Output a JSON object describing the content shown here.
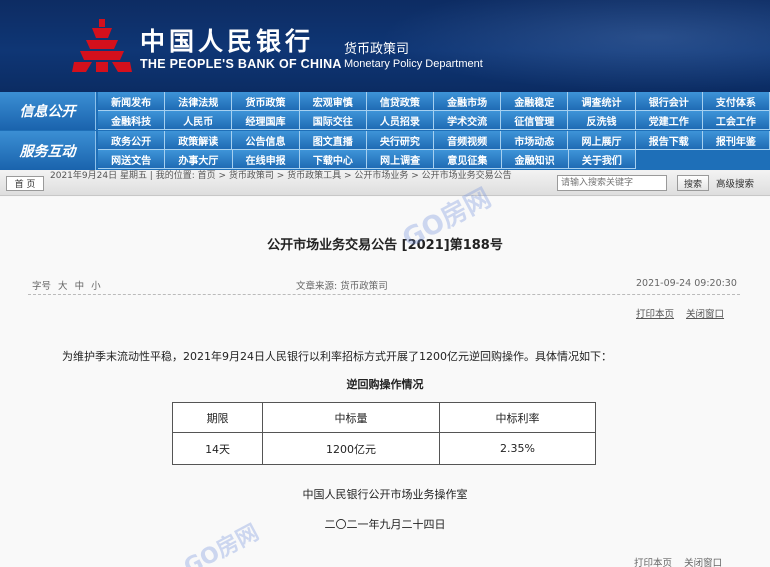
{
  "header": {
    "bank_name_cn": "中国人民银行",
    "bank_name_en": "THE PEOPLE'S BANK OF CHINA",
    "dept_cn": "货币政策司",
    "dept_en": "Monetary Policy Department"
  },
  "nav": {
    "block_1": "信息公开",
    "block_2": "服务互动",
    "rows": [
      [
        "新闻发布",
        "法律法规",
        "货币政策",
        "宏观审慎",
        "信贷政策",
        "金融市场",
        "金融稳定",
        "调查统计",
        "银行会计",
        "支付体系"
      ],
      [
        "金融科技",
        "人民币",
        "经理国库",
        "国际交往",
        "人员招录",
        "学术交流",
        "征信管理",
        "反洗钱",
        "党建工作",
        "工会工作"
      ],
      [
        "政务公开",
        "政策解读",
        "公告信息",
        "图文直播",
        "央行研究",
        "音频视频",
        "市场动态",
        "网上展厅",
        "报告下载",
        "报刊年鉴"
      ],
      [
        "网送文告",
        "办事大厅",
        "在线申报",
        "下载中心",
        "网上调查",
        "意见征集",
        "金融知识",
        "关于我们"
      ]
    ]
  },
  "crumb_bar": {
    "home_label": "首 页",
    "breadcrumb": "2021年9月24日 星期五 | 我的位置: 首页 > 货币政策司 > 货币政策工具 > 公开市场业务 > 公开市场业务交易公告",
    "search_placeholder": "请输入搜索关键字",
    "search_button": "搜索",
    "advanced_search": "高级搜索"
  },
  "article": {
    "title": "公开市场业务交易公告 [2021]第188号",
    "font_size_label": "字号",
    "font_sizes": [
      "大",
      "中",
      "小"
    ],
    "source": "文章来源: 货币政策司",
    "timestamp": "2021-09-24 09:20:30",
    "print_link": "打印本页",
    "close_link": "关闭窗口",
    "body": "为维护季末流动性平稳，2021年9月24日人民银行以利率招标方式开展了1200亿元逆回购操作。具体情况如下：",
    "table_caption": "逆回购操作情况",
    "table": {
      "headers": [
        "期限",
        "中标量",
        "中标利率"
      ],
      "rows": [
        [
          "14天",
          "1200亿元",
          "2.35%"
        ]
      ]
    },
    "signature": "中国人民银行公开市场业务操作室",
    "date": "二〇二一年九月二十四日",
    "bottom_links": "打印本页    关闭窗口"
  },
  "watermark": "GO房网",
  "colors": {
    "header_bg": "#0f3675",
    "nav_bg": "#1e6fb8",
    "emblem_red": "#d4101c"
  }
}
